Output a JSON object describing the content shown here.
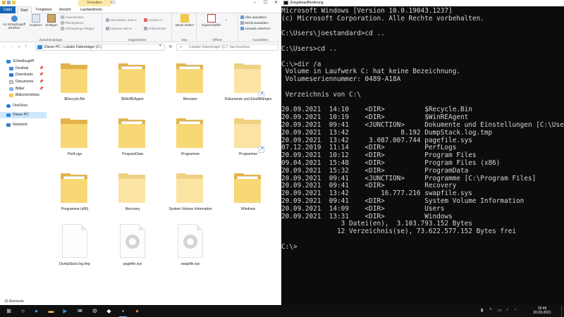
{
  "explorer": {
    "context_tab": "Verwalten",
    "window_path": "C:\\",
    "tabs": [
      "Datei",
      "Start",
      "Freigeben",
      "Ansicht",
      "Laufwerktools"
    ],
    "ribbon": {
      "pin_label": "An Schnellzugriff anheften",
      "copy_label": "Kopieren",
      "paste_label": "Einfügen",
      "cut_label": "Ausschneiden",
      "copy_path_label": "Pfad kopieren",
      "paste_shortcut_label": "Verknüpfung einfügen",
      "group_clipboard": "Zwischenablage",
      "move_to_label": "Verschieben nach",
      "copy_to_label": "Kopieren nach",
      "delete_label": "Löschen",
      "rename_label": "Umbenennen",
      "group_organize": "Organisieren",
      "new_folder_label": "Neuer Ordner",
      "group_new": "Neu",
      "properties_label": "Eigenschaften",
      "group_open": "Öffnen",
      "select_all_label": "Alles auswählen",
      "select_none_label": "Nichts auswählen",
      "invert_selection_label": "Auswahl umkehren",
      "group_select": "Auswählen"
    },
    "address": {
      "path": "Dieser PC  ›  Lokaler Datenträger (C:)",
      "search_placeholder": "\"Lokaler Datenträger (C:)\" durchsuchen"
    },
    "nav": [
      {
        "label": "Schnellzugriff",
        "icon": "star-icon"
      },
      {
        "label": "Desktop",
        "icon": "desktop-icon"
      },
      {
        "label": "Downloads",
        "icon": "download-icon"
      },
      {
        "label": "Dokumente",
        "icon": "documents-icon"
      },
      {
        "label": "Bilder",
        "icon": "pictures-icon"
      },
      {
        "label": "Bildschirmfotos",
        "icon": "folder-icon"
      },
      {
        "label": "OneDrive",
        "icon": "cloud-icon"
      },
      {
        "label": "Dieser PC",
        "icon": "computer-icon"
      },
      {
        "label": "Netzwerk",
        "icon": "network-icon"
      }
    ],
    "files": [
      {
        "name": "$Recycle.Bin",
        "kind": "folder-empty"
      },
      {
        "name": "$WinREAgent",
        "kind": "folder-empty"
      },
      {
        "name": "Benutzer",
        "kind": "folder-full"
      },
      {
        "name": "Dokumente und Einstellungen",
        "kind": "folder-shortcut"
      },
      {
        "name": "PerfLogs",
        "kind": "folder-empty"
      },
      {
        "name": "ProgramData",
        "kind": "folder-full"
      },
      {
        "name": "Programme",
        "kind": "folder-full"
      },
      {
        "name": "Programme",
        "kind": "folder-shortcut"
      },
      {
        "name": "Programme (x86)",
        "kind": "folder-full"
      },
      {
        "name": "Recovery",
        "kind": "folder-empty"
      },
      {
        "name": "System Volume Information",
        "kind": "folder-empty"
      },
      {
        "name": "Windows",
        "kind": "folder-full"
      },
      {
        "name": "DumpStack.log.tmp",
        "kind": "file"
      },
      {
        "name": "pagefile.sys",
        "kind": "system-file"
      },
      {
        "name": "swapfile.sys",
        "kind": "system-file"
      }
    ],
    "status": "15 Elemente"
  },
  "console": {
    "title": "Eingabeaufforderung",
    "lines": [
      "Microsoft Windows [Version 10.0.19043.1237]",
      "(c) Microsoft Corporation. Alle Rechte vorbehalten.",
      "",
      "C:\\Users\\joestandard>cd ..",
      "",
      "C:\\Users>cd ..",
      "",
      "C:\\>dir /a",
      " Volume in Laufwerk C: hat keine Bezeichnung.",
      " Volumeseriennummer: 0489-A18A",
      "",
      " Verzeichnis von C:\\",
      "",
      "20.09.2021  14:10    <DIR>          $Recycle.Bin",
      "20.09.2021  10:19    <DIR>          $WinREAgent",
      "20.09.2021  09:41    <JUNCTION>     Dokumente und Einstellungen [C:\\Users]",
      "20.09.2021  13:42             8.192 DumpStack.log.tmp",
      "20.09.2021  13:42     3.087.007.744 pagefile.sys",
      "07.12.2019  11:14    <DIR>          PerfLogs",
      "20.09.2021  10:12    <DIR>          Program Files",
      "09.04.2021  15:48    <DIR>          Program Files (x86)",
      "20.09.2021  15:32    <DIR>          ProgramData",
      "20.09.2021  09:41    <JUNCTION>     Programme [C:\\Program Files]",
      "20.09.2021  09:41    <DIR>          Recovery",
      "20.09.2021  13:42        16.777.216 swapfile.sys",
      "20.09.2021  09:41    <DIR>          System Volume Information",
      "20.09.2021  14:09    <DIR>          Users",
      "20.09.2021  13:31    <DIR>          Windows",
      "               3 Datei(en),  3.103.793.152 Bytes",
      "              12 Verzeichnis(se), 73.622.577.152 Bytes frei",
      "",
      "C:\\>"
    ]
  },
  "taskbar": {
    "time": "15:49",
    "date": "20.09.2021",
    "apps": [
      "start-icon",
      "search-icon",
      "edge-icon",
      "explorer-icon",
      "powershell-icon",
      "mail-icon",
      "settings-icon",
      "cmd-icon",
      "firefox-icon"
    ]
  }
}
